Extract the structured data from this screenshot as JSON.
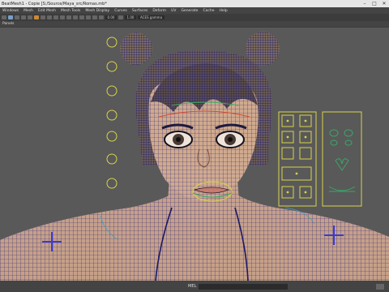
{
  "window": {
    "title": "BeatMesh1 - Copie [S:/Source/Maya_src/Romas.mb*",
    "minimize": "–",
    "maximize": "□",
    "close": "✕"
  },
  "menubar": {
    "items": [
      "Windows",
      "Mesh",
      "Edit Mesh",
      "Mesh Tools",
      "Mesh Display",
      "Curves",
      "Surfaces",
      "Deform",
      "UV",
      "Generate",
      "Cache",
      "Help"
    ]
  },
  "toolbar": {
    "field_a": "0.00",
    "field_b": "1.00",
    "colorspace": "ACES gamma",
    "panel_menu": "Panels"
  },
  "status": {
    "mel_label": "MEL"
  },
  "colors": {
    "wire": "#26207a",
    "skin": "#c9a48c",
    "controls": "#d8d24a",
    "accent": "#3aa868",
    "rig_red": "#d84a32"
  },
  "icons": [
    "mirror-icon",
    "select-icon",
    "lasso-icon",
    "paint-icon",
    "magnet-icon",
    "render-icon",
    "camera-icon"
  ]
}
